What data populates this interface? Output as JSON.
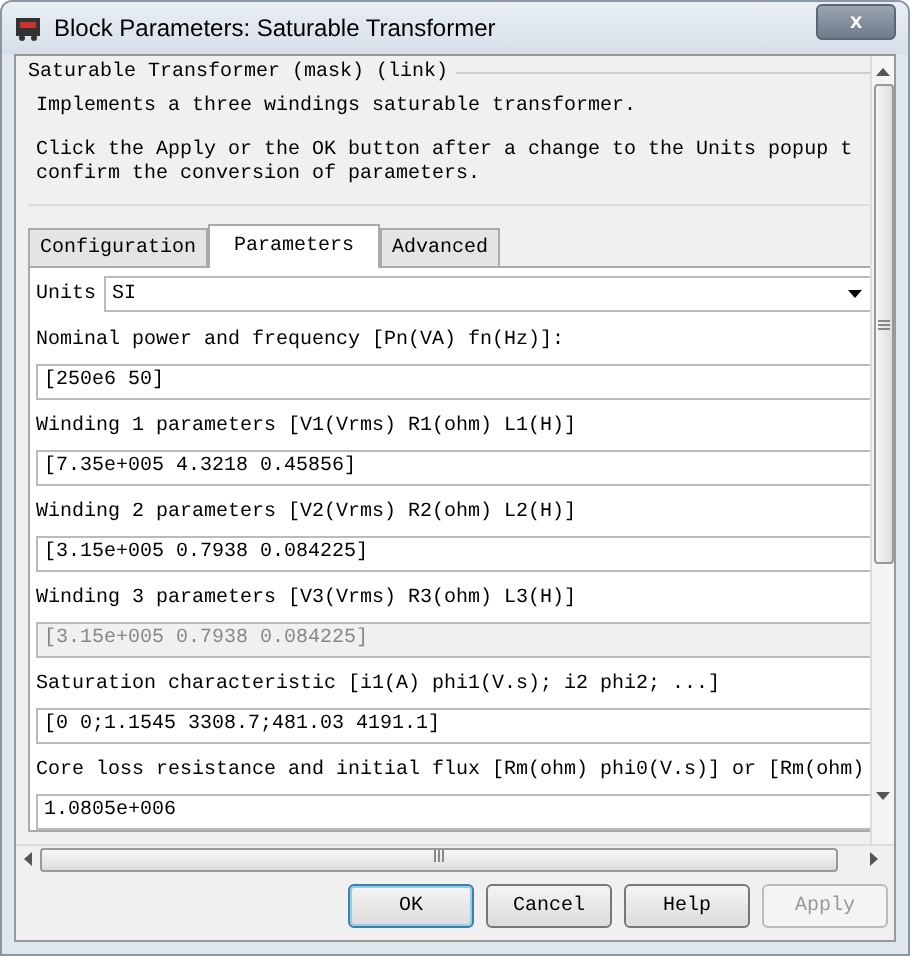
{
  "window": {
    "title": "Block Parameters: Saturable Transformer",
    "close": "x"
  },
  "group_title": "Saturable Transformer (mask) (link)",
  "description": "Implements a three windings saturable transformer.",
  "note": "Click the Apply or the OK button after a change to the Units popup t\nconfirm the conversion of parameters.",
  "tabs": [
    {
      "label": "Configuration",
      "selected": false
    },
    {
      "label": "Parameters",
      "selected": true
    },
    {
      "label": "Advanced",
      "selected": false
    }
  ],
  "units": {
    "label": "Units",
    "value": "SI"
  },
  "params": [
    {
      "label": "Nominal power and frequency [Pn(VA) fn(Hz)]:",
      "value": "[250e6 50]",
      "disabled": false
    },
    {
      "label": "Winding 1 parameters [V1(Vrms) R1(ohm) L1(H)]",
      "value": "[7.35e+005 4.3218 0.45856]",
      "disabled": false
    },
    {
      "label": "Winding 2 parameters [V2(Vrms) R2(ohm) L2(H)]",
      "value": "[3.15e+005 0.7938 0.084225]",
      "disabled": false
    },
    {
      "label": "Winding 3 parameters [V3(Vrms) R3(ohm) L3(H)]",
      "value": "[3.15e+005 0.7938 0.084225]",
      "disabled": true
    },
    {
      "label": "Saturation characteristic [i1(A) phi1(V.s); i2 phi2; ...]",
      "value": "[0 0;1.1545 3308.7;481.03 4191.1]",
      "disabled": false
    },
    {
      "label": "Core loss resistance and initial flux [Rm(ohm) phi0(V.s)] or [Rm(ohm)",
      "value": "1.0805e+006",
      "disabled": false
    }
  ],
  "buttons": [
    {
      "label": "OK",
      "disabled": false,
      "default": true
    },
    {
      "label": "Cancel",
      "disabled": false,
      "default": false
    },
    {
      "label": "Help",
      "disabled": false,
      "default": false
    },
    {
      "label": "Apply",
      "disabled": true,
      "default": false
    }
  ]
}
